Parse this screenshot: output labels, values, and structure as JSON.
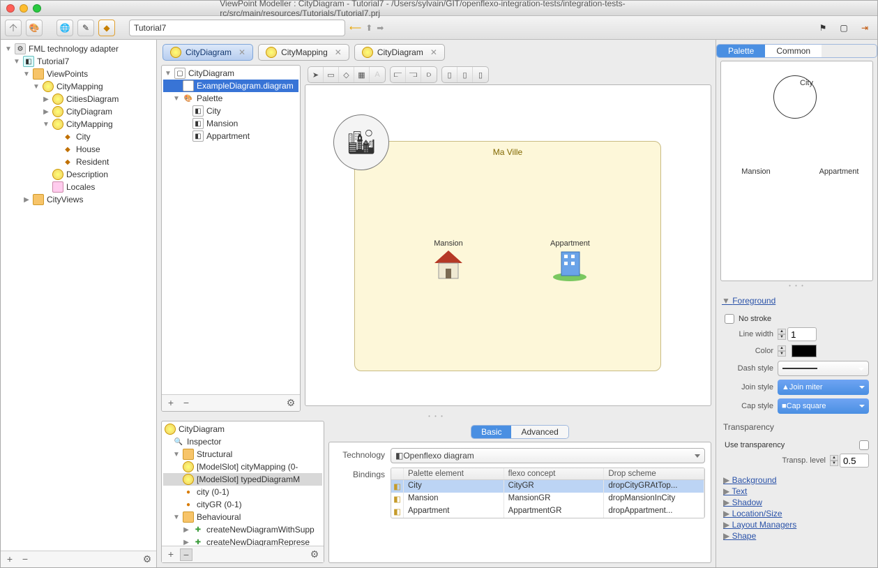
{
  "window": {
    "title": "ViewPoint Modeller : CityDiagram - Tutorial7 - /Users/sylvain/GIT/openflexo-integration-tests/integration-tests-rc/src/main/resources/Tutorials/Tutorial7.prj"
  },
  "toolbar": {
    "address": "Tutorial7"
  },
  "leftTree": {
    "root": "FML technology adapter",
    "project": "Tutorial7",
    "viewpoints": "ViewPoints",
    "cityMapping": "CityMapping",
    "citiesDiagram": "CitiesDiagram",
    "cityDiagram": "CityDiagram",
    "cityMapping2": "CityMapping",
    "city": "City",
    "house": "House",
    "resident": "Resident",
    "description": "Description",
    "locales": "Locales",
    "cityViews": "CityViews"
  },
  "tabs": [
    {
      "label": "CityDiagram",
      "active": true
    },
    {
      "label": "CityMapping",
      "active": false
    },
    {
      "label": "CityDiagram",
      "active": false
    }
  ],
  "miniTree": {
    "root": "CityDiagram",
    "example": "ExampleDiagram.diagram",
    "palette": "Palette",
    "items": [
      "City",
      "Mansion",
      "Appartment"
    ]
  },
  "diagram": {
    "cityLabel": "Ma Ville",
    "mansion": "Mansion",
    "appartment": "Appartment"
  },
  "lowerLeft": {
    "root": "CityDiagram",
    "inspector": "Inspector",
    "structural": "Structural",
    "slot1": "[ModelSlot] cityMapping (0-",
    "slot2": "[ModelSlot] typedDiagramM",
    "city": "city (0-1)",
    "cityGR": "cityGR (0-1)",
    "behavioural": "Behavioural",
    "b1": "createNewDiagramWithSupp",
    "b2": "createNewDiagramReprese"
  },
  "lowerRight": {
    "seg": {
      "on": "Basic",
      "off": "Advanced"
    },
    "technologyLabel": "Technology",
    "technologyValue": "Openflexo diagram",
    "bindingsLabel": "Bindings",
    "columns": [
      "Palette element",
      "flexo concept",
      "Drop scheme"
    ],
    "rows": [
      [
        "City",
        "CityGR",
        "dropCityGRAtTop..."
      ],
      [
        "Mansion",
        "MansionGR",
        "dropMansionInCity"
      ],
      [
        "Appartment",
        "AppartmentGR",
        "dropAppartment..."
      ]
    ]
  },
  "rightPane": {
    "tabs": {
      "on": "Palette",
      "off": "Common"
    },
    "pal": {
      "city": "City",
      "mansion": "Mansion",
      "appartment": "Appartment"
    },
    "foreground": {
      "title": "Foreground",
      "noStroke": "No stroke",
      "lineWidth": "Line width",
      "lineWidthVal": "1",
      "color": "Color",
      "dashStyle": "Dash style",
      "joinStyle": "Join style",
      "joinVal": "Join miter",
      "capStyle": "Cap style",
      "capVal": "Cap square"
    },
    "transparency": {
      "title": "Transparency",
      "use": "Use transparency",
      "level": "Transp. level",
      "levelVal": "0.5"
    },
    "links": [
      "Background",
      "Text",
      "Shadow",
      "Location/Size",
      "Layout Managers",
      "Shape"
    ]
  }
}
